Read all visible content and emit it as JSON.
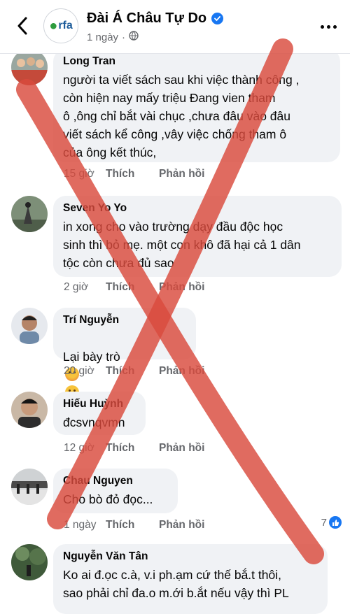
{
  "header": {
    "page_name": "Đài Á Châu Tự Do",
    "post_time": "1 ngày",
    "logo_text": "rfa",
    "icons": [
      "back-arrow-icon",
      "verified-badge-icon",
      "globe-icon",
      "more-options-icon"
    ]
  },
  "actions": {
    "like": "Thích",
    "reply": "Phản hồi"
  },
  "comments": [
    {
      "author": "Long Tran",
      "text": "người ta viết sách sau khi việc thành công ,\ncòn hiện nay mấy triệu Đang vien tham\nô ,ông chỉ bắt vài chục ,chưa đâu vào đâu\nviết sách kể công ,vây việc chống tham ô\ncủa ông kết thúc,",
      "time": "15 giờ"
    },
    {
      "author": "Seven Yo Yo",
      "text": "in xong cho vào trường dạy đầu độc học\nsinh thì bỏ mẹ. một con khô đã hại cả 1 dân\ntộc còn chưa đủ sao",
      "time": "2 giờ"
    },
    {
      "author": "Trí Nguyễn",
      "text": "Lại bày trò",
      "time": "20 giờ"
    },
    {
      "author": "Hiếu Huỳnh",
      "text": "đcsvnqvmn",
      "time": "12 giờ"
    },
    {
      "author": "Chau Nguyen",
      "text": "Cho bò đỏ đọc...",
      "time": "1 ngày",
      "reaction_count": "7"
    },
    {
      "author": "Nguyễn Văn Tân",
      "text": "Ko ai đ.ọc c.à, v.i ph.ạm cứ thế bắ.t thôi,\nsao phải chỉ đa.o m.ới b.ắt nếu vậy thì PL",
      "time": ""
    }
  ],
  "colors": {
    "bubble": "#f0f2f5",
    "meta_text": "#65676b",
    "accent": "#1877f2",
    "overlay_x": "#d94a3d"
  }
}
